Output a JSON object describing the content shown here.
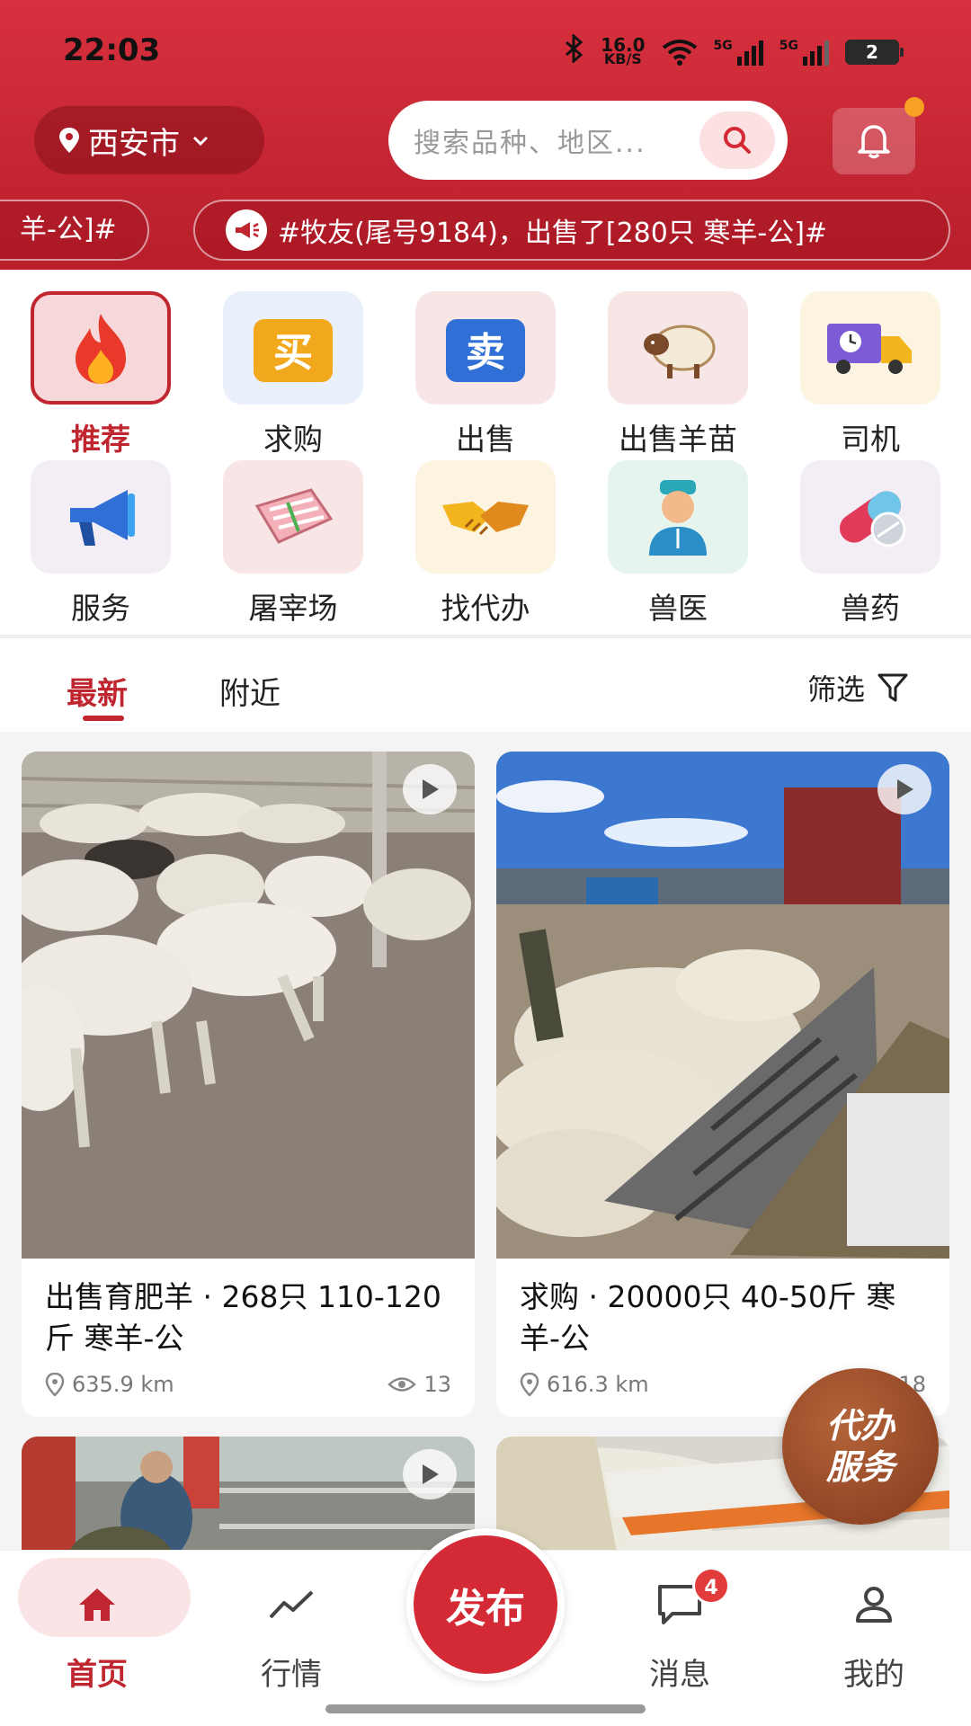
{
  "status": {
    "time": "22:03",
    "net_speed": "16.0",
    "net_unit": "KB/S",
    "sig1": "5G",
    "sig2": "5G",
    "battery": "2"
  },
  "header": {
    "city": "西安市",
    "search_placeholder": "搜索品种、地区...",
    "ticker_prev": "羊-公]#",
    "ticker": "#牧友(尾号9184)，出售了[280只 寒羊-公]#"
  },
  "categories": [
    {
      "label": "推荐",
      "icon": "fire-icon"
    },
    {
      "label": "求购",
      "icon": "buy-icon",
      "glyph": "买"
    },
    {
      "label": "出售",
      "icon": "sell-icon",
      "glyph": "卖"
    },
    {
      "label": "出售羊苗",
      "icon": "sheep-icon"
    },
    {
      "label": "司机",
      "icon": "truck-icon"
    },
    {
      "label": "服务",
      "icon": "megaphone-icon"
    },
    {
      "label": "屠宰场",
      "icon": "meat-icon"
    },
    {
      "label": "找代办",
      "icon": "handshake-icon"
    },
    {
      "label": "兽医",
      "icon": "vet-icon"
    },
    {
      "label": "兽药",
      "icon": "pill-icon"
    }
  ],
  "tabs": {
    "latest": "最新",
    "nearby": "附近",
    "filter": "筛选"
  },
  "cards": [
    {
      "title": "出售育肥羊 · 268只 110-120斤 寒羊-公",
      "distance": "635.9 km",
      "views": "13"
    },
    {
      "title": "求购 · 20000只 40-50斤 寒羊-公",
      "distance": "616.3 km",
      "views": "18"
    }
  ],
  "fab": {
    "line1": "代办",
    "line2": "服务"
  },
  "nav": {
    "home": "首页",
    "market": "行情",
    "publish": "发布",
    "messages": "消息",
    "messages_badge": "4",
    "mine": "我的"
  },
  "colors": {
    "brand": "#c0262f",
    "header": "#d8303e",
    "fab": "#9a4a2a"
  }
}
